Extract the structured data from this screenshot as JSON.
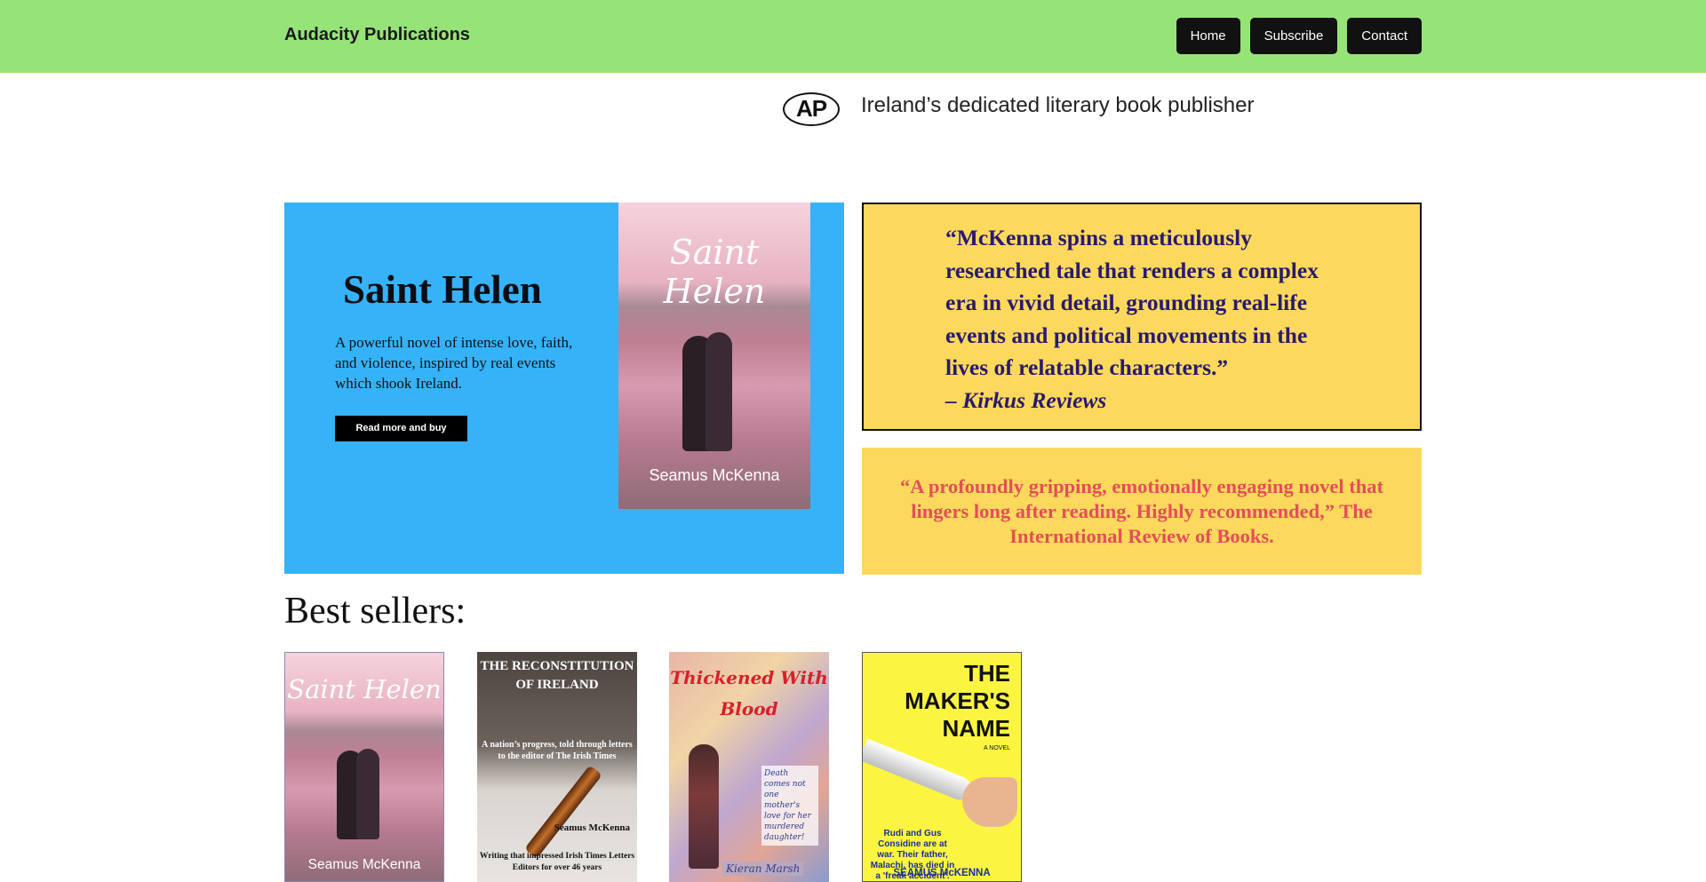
{
  "header": {
    "site_title": "Audacity Publications",
    "nav": [
      "Home",
      "Subscribe",
      "Contact"
    ],
    "background": "#96e477"
  },
  "brand": {
    "logo_text": "AP",
    "tagline": "Ireland’s dedicated literary book publisher"
  },
  "feature": {
    "background": "#36b2f9",
    "title": "Saint Helen",
    "description": "A powerful novel of intense love, faith, and violence, inspired by real events which shook Ireland.",
    "cta": "Read more and buy",
    "cover_title": "Saint Helen",
    "cover_author": "Seamus McKenna"
  },
  "quotes": [
    {
      "text": "“McKenna spins a meticulously researched tale that renders a complex era in vivid detail, grounding real-life events and political movements in the lives of relatable characters.”",
      "source": "– Kirkus Reviews"
    },
    {
      "text": "“A profoundly gripping, emotionally engaging novel that lingers long after reading. Highly recommended,” The International Review of Books."
    }
  ],
  "best_sellers": {
    "heading": "Best sellers:",
    "books": [
      {
        "title": "Saint Helen",
        "author": "Seamus McKenna"
      },
      {
        "title": "THE RECONSTITUTION OF IRELAND",
        "subtitle": "A nation’s progress, told through letters to the editor of The Irish Times",
        "author": "Seamus McKenna",
        "footer": "Writing that impressed Irish Times Letters Editors for over 46 years"
      },
      {
        "title": "Thickened With Blood",
        "quote": "Death comes not one mother's love for her murdered daughter!",
        "author": "Kieran Marsh"
      },
      {
        "title": "THE MAKER'S NAME",
        "label": "A NOVEL",
        "blurb": "Rudi and Gus Considine are at war. Their father, Malachi, has died in a 'freak accident'.",
        "author": "SEAMUS McKENNA"
      }
    ]
  }
}
